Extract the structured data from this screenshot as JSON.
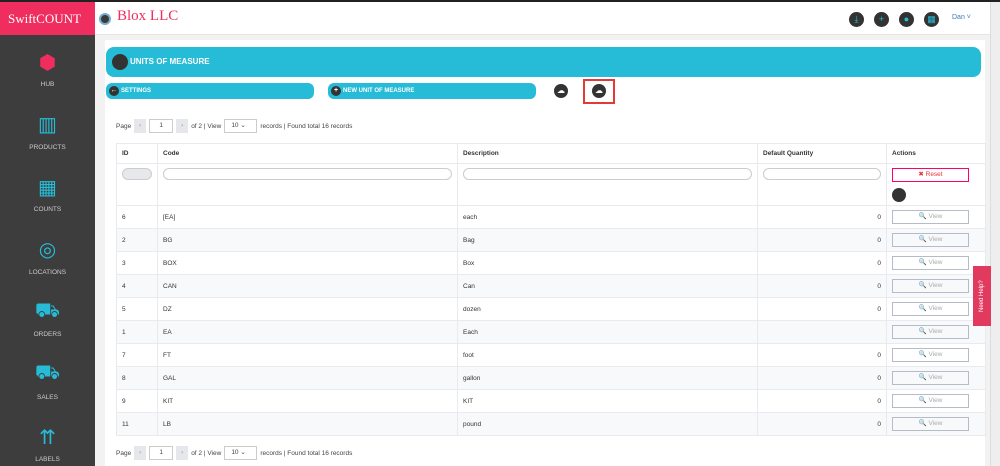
{
  "app": {
    "brand": "SwiftCOUNT",
    "company": "Blox LLC",
    "user": "Dan ˅"
  },
  "sidebar": [
    "HUB",
    "PRODUCTS",
    "COUNTS",
    "LOCATIONS",
    "ORDERS",
    "SALES",
    "LABELS"
  ],
  "page": {
    "title": "UNITS OF MEASURE",
    "settings": "SETTINGS",
    "new": "NEW UNIT OF MEASURE"
  },
  "pager": {
    "page_label": "Page",
    "page": "1",
    "of": "of 2 | View",
    "view": "10",
    "found": "records | Found total 16 records"
  },
  "table": {
    "headers": [
      "ID",
      "Code",
      "Description",
      "Default Quantity",
      "Actions"
    ],
    "reset": "✖ Reset",
    "view": "🔍 View",
    "rows": [
      [
        "6",
        "[EA]",
        "each",
        "0"
      ],
      [
        "2",
        "BG",
        "Bag",
        "0"
      ],
      [
        "3",
        "BOX",
        "Box",
        "0"
      ],
      [
        "4",
        "CAN",
        "Can",
        "0"
      ],
      [
        "5",
        "DZ",
        "dozen",
        "0"
      ],
      [
        "1",
        "EA",
        "Each",
        ""
      ],
      [
        "7",
        "FT",
        "foot",
        "0"
      ],
      [
        "8",
        "GAL",
        "gallon",
        "0"
      ],
      [
        "9",
        "KIT",
        "KIT",
        "0"
      ],
      [
        "11",
        "LB",
        "pound",
        "0"
      ]
    ]
  },
  "help": "Need Help?"
}
